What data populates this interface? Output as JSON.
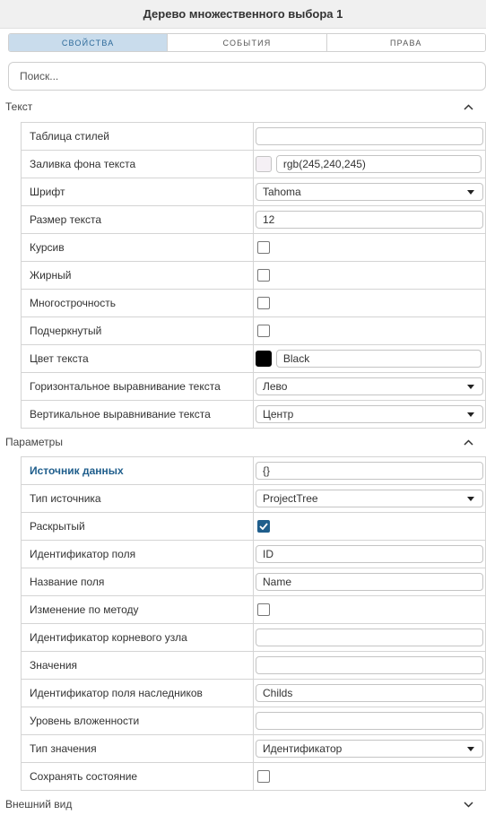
{
  "window": {
    "title": "Дерево множественного выбора 1"
  },
  "tabs": [
    {
      "label": "СВОЙСТВА",
      "active": true
    },
    {
      "label": "СОБЫТИЯ",
      "active": false
    },
    {
      "label": "ПРАВА",
      "active": false
    }
  ],
  "search": {
    "placeholder": "Поиск..."
  },
  "sections": {
    "text": {
      "title": "Текст",
      "expanded": true,
      "rows": {
        "style_table": {
          "label": "Таблица стилей",
          "value": ""
        },
        "text_bg": {
          "label": "Заливка фона текста",
          "value": "rgb(245,240,245)",
          "swatch": "#f5f0f5"
        },
        "font": {
          "label": "Шрифт",
          "value": "Tahoma"
        },
        "font_size": {
          "label": "Размер текста",
          "value": "12"
        },
        "italic": {
          "label": "Курсив",
          "checked": false
        },
        "bold": {
          "label": "Жирный",
          "checked": false
        },
        "multiline": {
          "label": "Многострочность",
          "checked": false
        },
        "underline": {
          "label": "Подчеркнутый",
          "checked": false
        },
        "text_color": {
          "label": "Цвет текста",
          "value": "Black",
          "swatch": "#000000"
        },
        "h_align": {
          "label": "Горизонтальное выравнивание текста",
          "value": "Лево"
        },
        "v_align": {
          "label": "Вертикальное выравнивание текста",
          "value": "Центр"
        }
      }
    },
    "params": {
      "title": "Параметры",
      "expanded": true,
      "rows": {
        "data_source": {
          "label": "Источник данных",
          "value": "{}"
        },
        "source_type": {
          "label": "Тип источника",
          "value": "ProjectTree"
        },
        "expanded": {
          "label": "Раскрытый",
          "checked": true
        },
        "field_id": {
          "label": "Идентификатор поля",
          "value": "ID"
        },
        "field_name": {
          "label": "Название поля",
          "value": "Name"
        },
        "change_by_method": {
          "label": "Изменение по методу",
          "checked": false
        },
        "root_id": {
          "label": "Идентификатор корневого узла",
          "value": ""
        },
        "values": {
          "label": "Значения",
          "value": ""
        },
        "child_field_id": {
          "label": "Идентификатор поля наследников",
          "value": "Childs"
        },
        "nesting_level": {
          "label": "Уровень вложенности",
          "value": ""
        },
        "value_type": {
          "label": "Тип значения",
          "value": "Идентификатор"
        },
        "save_state": {
          "label": "Сохранять состояние",
          "checked": false
        }
      }
    },
    "appearance": {
      "title": "Внешний вид",
      "expanded": false
    }
  },
  "colors": {
    "accent": "#1f5e8c",
    "active_tab_bg": "#c9dcec"
  }
}
